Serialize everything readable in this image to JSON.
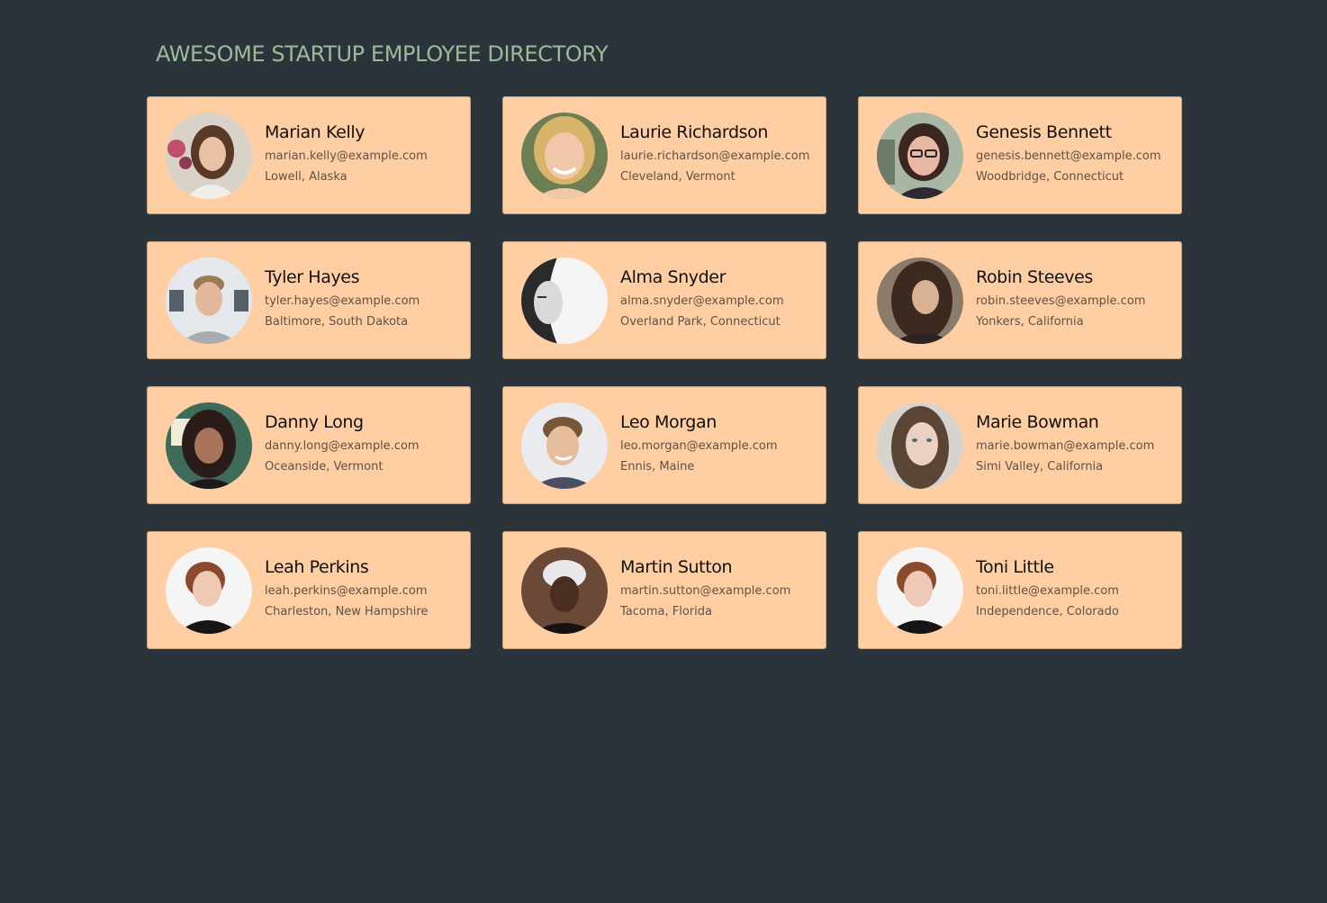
{
  "page": {
    "title": "AWESOME STARTUP EMPLOYEE DIRECTORY"
  },
  "colors": {
    "background": "#2b333b",
    "title": "#9bbc97",
    "card": "#ffcea3",
    "card_border": "#c9a47f",
    "name": "#111111",
    "detail": "#5f5247"
  },
  "employees": [
    {
      "name": "Marian Kelly",
      "email": "marian.kelly@example.com",
      "location": "Lowell, Alaska",
      "avatar": "portrait-photo"
    },
    {
      "name": "Laurie Richardson",
      "email": "laurie.richardson@example.com",
      "location": "Cleveland, Vermont",
      "avatar": "portrait-photo"
    },
    {
      "name": "Genesis Bennett",
      "email": "genesis.bennett@example.com",
      "location": "Woodbridge, Connecticut",
      "avatar": "portrait-photo"
    },
    {
      "name": "Tyler Hayes",
      "email": "tyler.hayes@example.com",
      "location": "Baltimore, South Dakota",
      "avatar": "portrait-photo"
    },
    {
      "name": "Alma Snyder",
      "email": "alma.snyder@example.com",
      "location": "Overland Park, Connecticut",
      "avatar": "portrait-photo"
    },
    {
      "name": "Robin Steeves",
      "email": "robin.steeves@example.com",
      "location": "Yonkers, California",
      "avatar": "portrait-photo"
    },
    {
      "name": "Danny Long",
      "email": "danny.long@example.com",
      "location": "Oceanside, Vermont",
      "avatar": "portrait-photo"
    },
    {
      "name": "Leo Morgan",
      "email": "leo.morgan@example.com",
      "location": "Ennis, Maine",
      "avatar": "portrait-photo"
    },
    {
      "name": "Marie Bowman",
      "email": "marie.bowman@example.com",
      "location": "Simi Valley, California",
      "avatar": "portrait-photo"
    },
    {
      "name": "Leah Perkins",
      "email": "leah.perkins@example.com",
      "location": "Charleston, New Hampshire",
      "avatar": "portrait-photo"
    },
    {
      "name": "Martin Sutton",
      "email": "martin.sutton@example.com",
      "location": "Tacoma, Florida",
      "avatar": "portrait-photo"
    },
    {
      "name": "Toni Little",
      "email": "toni.little@example.com",
      "location": "Independence, Colorado",
      "avatar": "portrait-photo"
    }
  ]
}
